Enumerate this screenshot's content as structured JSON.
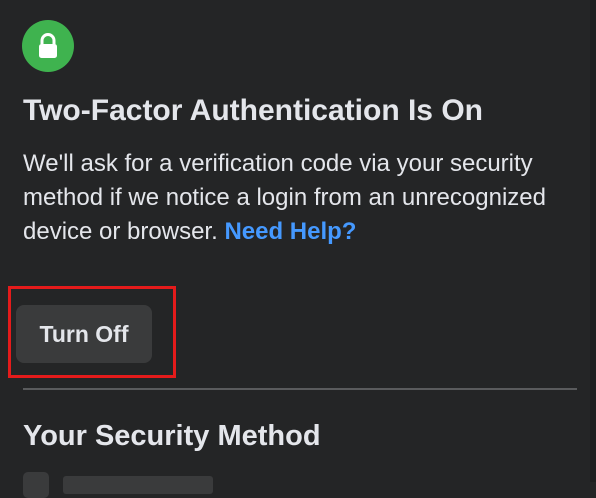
{
  "status": {
    "icon": "lock-icon",
    "badge_color": "#3fb34f",
    "title": "Two-Factor Authentication Is On"
  },
  "description": {
    "text": "We'll ask for a verification code via your security method if we notice a login from an unrecognized device or browser.",
    "help_link": "Need Help?",
    "link_color": "#4599ff"
  },
  "actions": {
    "turn_off_label": "Turn Off",
    "highlight_color": "#e41b1b"
  },
  "security_method": {
    "title": "Your Security Method"
  },
  "colors": {
    "background": "#242526",
    "text": "#e4e6eb",
    "button_background": "#3a3b3c"
  }
}
